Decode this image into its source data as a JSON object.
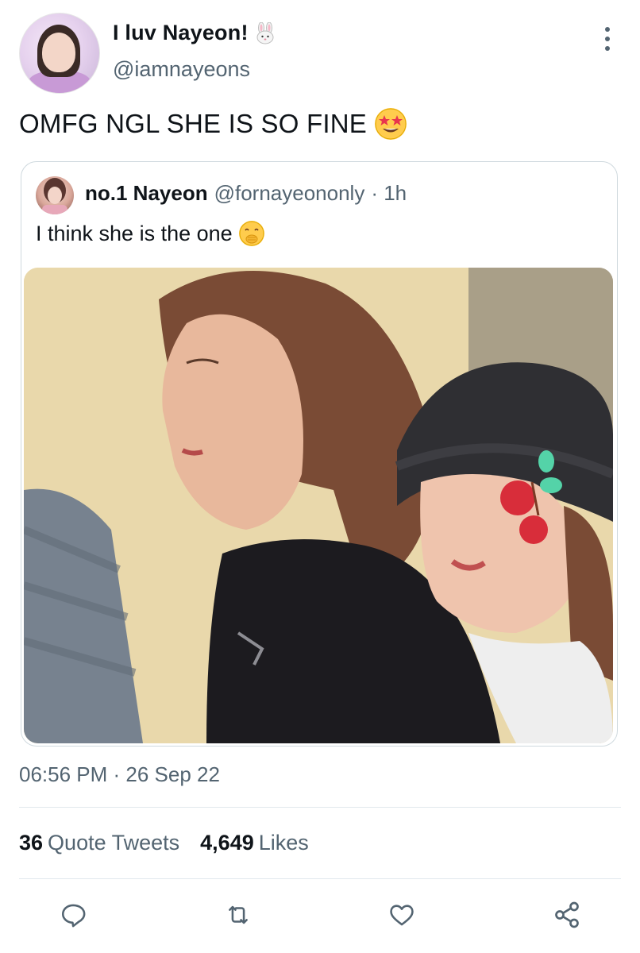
{
  "author": {
    "display_name": "I luv Nayeon!",
    "handle": "@iamnayeons",
    "name_emoji": "rabbit-face"
  },
  "tweet": {
    "text": "OMFG NGL SHE IS SO FINE",
    "emoji": "star-struck"
  },
  "quoted": {
    "display_name": "no.1 Nayeon",
    "handle": "@fornayeononly",
    "time": "· 1h",
    "text": "I think she is the one",
    "emoji": "face-with-hand-over-mouth"
  },
  "meta": {
    "timestamp": "06:56 PM · 26 Sep 22"
  },
  "stats": {
    "quote_tweets_count": "36",
    "quote_tweets_label": "Quote Tweets",
    "likes_count": "4,649",
    "likes_label": "Likes"
  },
  "actions": [
    "reply-icon",
    "retweet-icon",
    "like-icon",
    "share-icon"
  ],
  "colors": {
    "secondary_text": "#536471",
    "primary_text": "#0f1419",
    "border": "#cfd9de",
    "emoji_yellow": "#ffcc4d"
  }
}
